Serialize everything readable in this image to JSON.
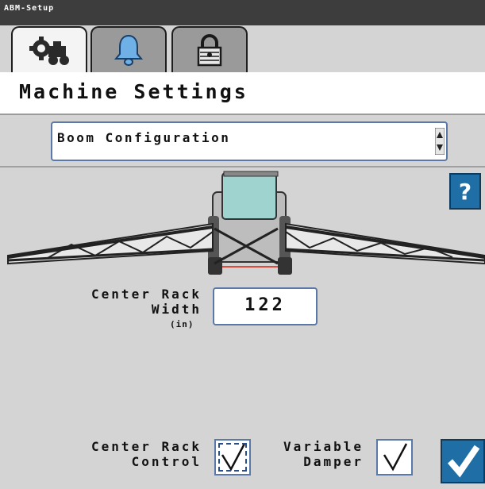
{
  "window": {
    "title": "ABM-Setup"
  },
  "tabs": [
    {
      "name": "settings",
      "icon": "gear-tractor-icon",
      "active": true
    },
    {
      "name": "alarms",
      "icon": "bell-icon",
      "active": false
    },
    {
      "name": "security",
      "icon": "padlock-icon",
      "active": false
    }
  ],
  "header": {
    "title": "Machine Settings"
  },
  "section_select": {
    "value": "Boom Configuration"
  },
  "help": {
    "label": "?"
  },
  "center_rack_width": {
    "label_line1": "Center Rack",
    "label_line2": "Width",
    "unit": "(in)",
    "value": "122"
  },
  "center_rack_control": {
    "label_line1": "Center Rack",
    "label_line2": "Control",
    "checked": true
  },
  "variable_damper": {
    "label_line1": "Variable",
    "label_line2": "Damper",
    "checked": true
  },
  "colors": {
    "accent": "#1f6fa6",
    "field_border": "#5b79a8",
    "background": "#d4d4d4",
    "titlebar": "#3d3d3d"
  }
}
